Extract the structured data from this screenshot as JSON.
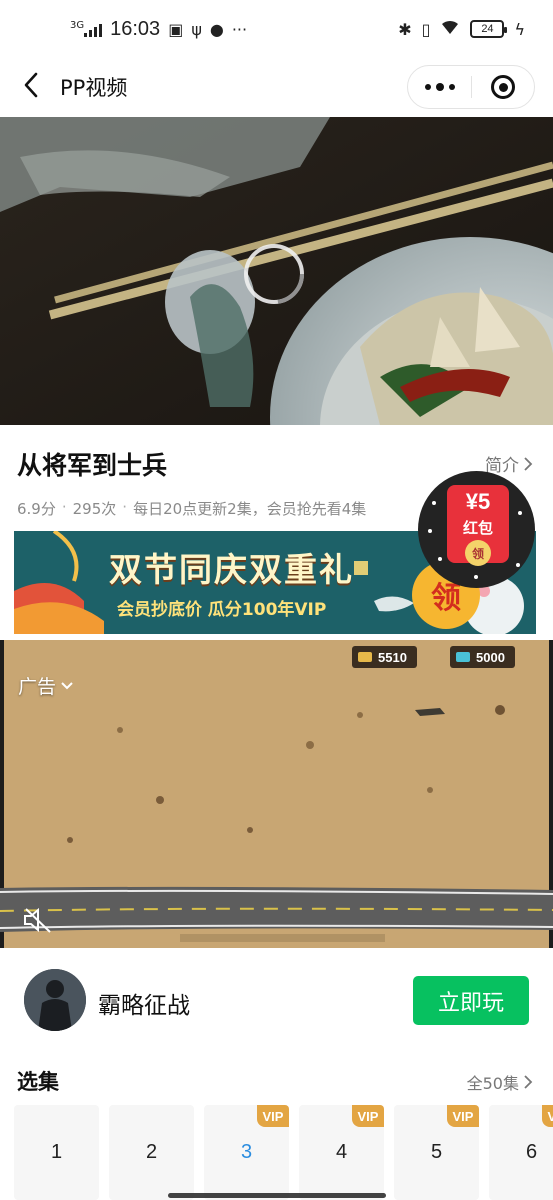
{
  "status_bar": {
    "network": "3G",
    "time": "16:03",
    "battery": "24"
  },
  "nav": {
    "title": "PP视频"
  },
  "video": {
    "title": "从将军到士兵",
    "intro_label": "简介",
    "rating": "6.9分",
    "plays": "295次",
    "schedule": "每日20点更新2集，会员抢先看4集"
  },
  "banner": {
    "headline": "双节同庆双重礼",
    "subline": "会员抄底价  瓜分100年VIP",
    "claim": "领"
  },
  "red_packet": {
    "amount": "¥5",
    "label": "红包",
    "button": "领"
  },
  "ad": {
    "label": "广告",
    "stat1": "5510",
    "stat2": "5000"
  },
  "game": {
    "name": "霸略征战",
    "play_label": "立即玩"
  },
  "episodes": {
    "heading": "选集",
    "all_label": "全50集",
    "items": [
      {
        "num": "1",
        "vip": ""
      },
      {
        "num": "2",
        "vip": ""
      },
      {
        "num": "3",
        "vip": "VIP"
      },
      {
        "num": "4",
        "vip": "VIP"
      },
      {
        "num": "5",
        "vip": "VIP"
      },
      {
        "num": "6",
        "vip": "VIP"
      }
    ],
    "active_index": 2
  },
  "colors": {
    "accent_green": "#07c160",
    "vip_gold": "#e3a543",
    "active_blue": "#2b8de0",
    "red_packet": "#e8313b"
  }
}
